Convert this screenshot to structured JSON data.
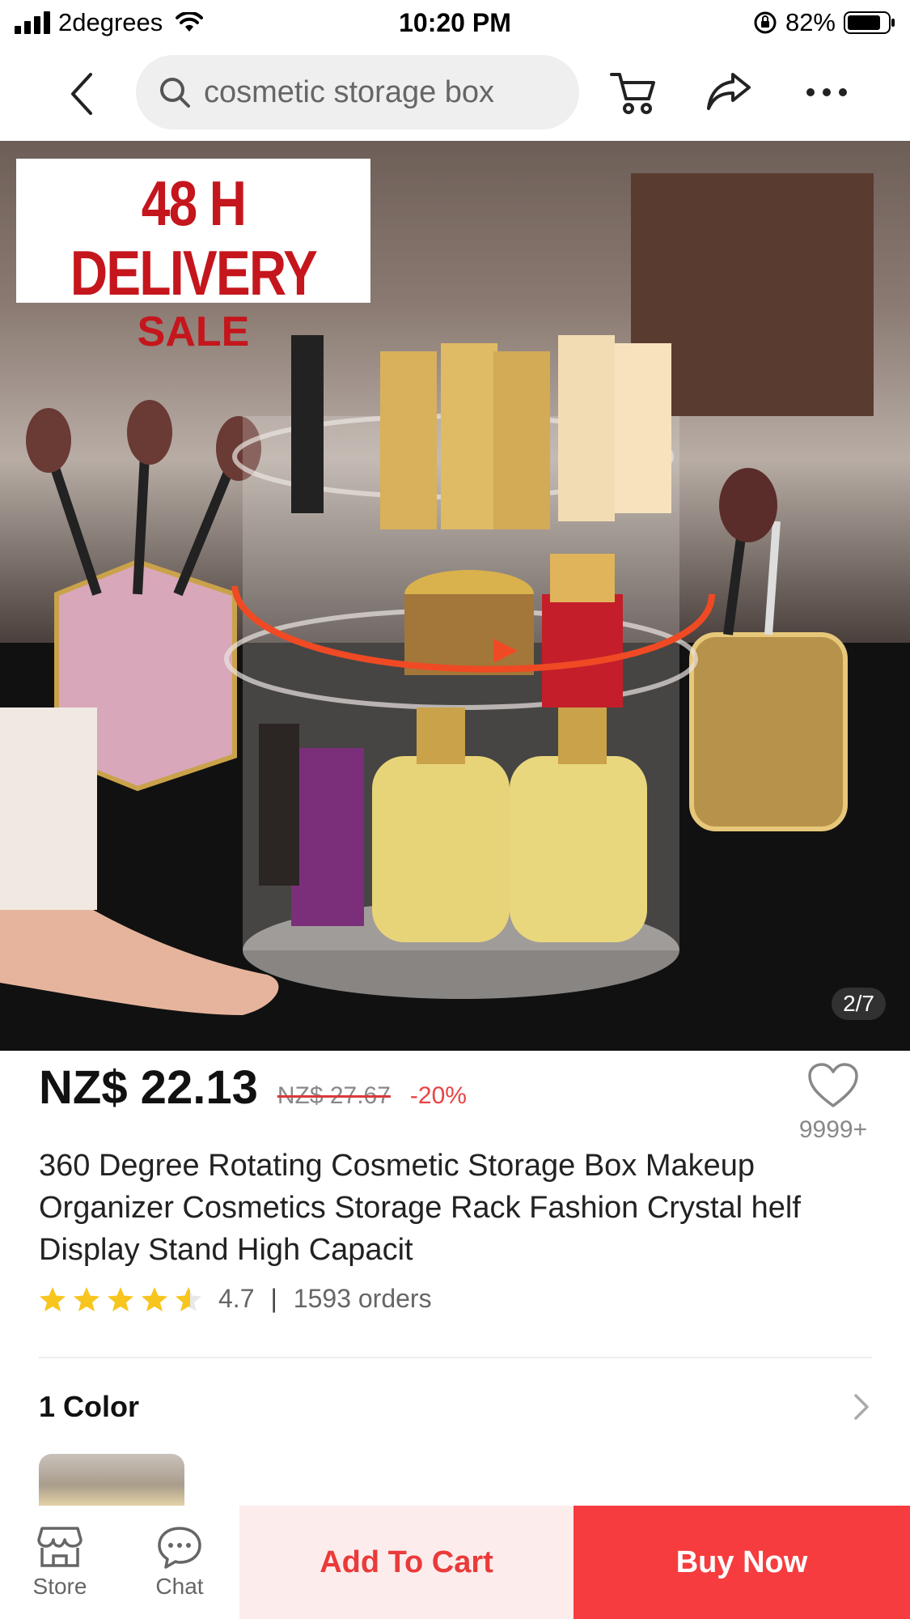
{
  "status_bar": {
    "carrier": "2degrees",
    "time": "10:20 PM",
    "battery": "82%"
  },
  "search": {
    "query": "cosmetic storage box"
  },
  "product": {
    "promo_line1": "48 H DELIVERY",
    "promo_line2": "SALE",
    "image_counter": "2/7",
    "price": "NZ$ 22.13",
    "original_price": "NZ$ 27.67",
    "discount": "-20%",
    "wishlist_count": "9999+",
    "title": "360 Degree Rotating Cosmetic Storage Box Makeup Organizer Cosmetics Storage Rack Fashion Crystal helf Display Stand High Capacit",
    "rating": "4.7",
    "rating_fraction": 0.94,
    "separator": "|",
    "orders": "1593 orders"
  },
  "color_section": {
    "title": "1 Color"
  },
  "bottom_bar": {
    "store_label": "Store",
    "chat_label": "Chat",
    "add_to_cart": "Add To Cart",
    "buy_now": "Buy Now"
  },
  "colors": {
    "accent": "#f63c3e",
    "accent_light": "#fdecec",
    "star": "#f7c51e",
    "promo_red": "#c4161c"
  },
  "icons": [
    "signal-icon",
    "wifi-icon",
    "rotation-lock-icon",
    "battery-icon",
    "back-icon",
    "search-icon",
    "cart-icon",
    "share-icon",
    "more-icon",
    "heart-icon",
    "star-icon",
    "chevron-right-icon",
    "store-icon",
    "chat-icon"
  ]
}
